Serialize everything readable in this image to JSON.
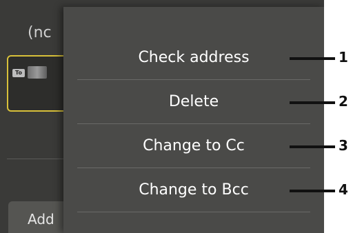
{
  "background_panel": {
    "header_fragment": "(nc",
    "add_button_fragment": "Add",
    "recipient_badge": "To"
  },
  "menu": {
    "items": [
      {
        "label": "Check address",
        "callout": "1"
      },
      {
        "label": "Delete",
        "callout": "2"
      },
      {
        "label": "Change to Cc",
        "callout": "3"
      },
      {
        "label": "Change to Bcc",
        "callout": "4"
      }
    ]
  },
  "colors": {
    "panel": "#3a3a38",
    "menu": "#4a4a48",
    "highlight_border": "#d8c13a",
    "callout": "#111111"
  }
}
